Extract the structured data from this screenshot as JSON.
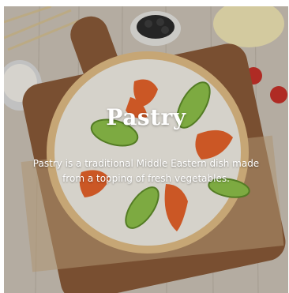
{
  "card": {
    "title": "Pastry",
    "description": "Pastry is a traditional Middle Eastern dish made from a topping of fresh vegetables.",
    "image_subject": "pastry-photo"
  },
  "colors": {
    "text": "#ffffff",
    "wood_table": "#cfc6ba",
    "board": "#8a5a38",
    "crust": "#e6c58f",
    "cream": "#f3efe6",
    "tomato": "#e8632b",
    "cucumber": "#8fc24a"
  }
}
